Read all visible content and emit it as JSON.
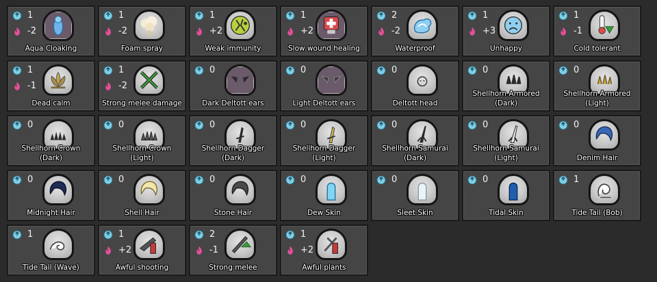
{
  "colors": {
    "background": "#2b2b2b",
    "card": "#454545",
    "water_icon": "#7ecfe6",
    "fire_icon": "#e64f9a"
  },
  "traits": [
    {
      "name": "Aqua Cloaking",
      "water": "1",
      "fire": "-2",
      "icon": "aqua-cloaking-icon"
    },
    {
      "name": "Foam spray",
      "water": "1",
      "fire": "-2",
      "icon": "foam-spray-icon"
    },
    {
      "name": "Weak immunity",
      "water": "1",
      "fire": "+2",
      "icon": "weak-immunity-icon"
    },
    {
      "name": "Slow wound healing",
      "water": "1",
      "fire": "+2",
      "icon": "slow-wound-healing-icon"
    },
    {
      "name": "Waterproof",
      "water": "2",
      "fire": "-2",
      "icon": "waterproof-icon"
    },
    {
      "name": "Unhappy",
      "water": "1",
      "fire": "+3",
      "icon": "unhappy-icon"
    },
    {
      "name": "Cold tolerant",
      "water": "1",
      "fire": "-1",
      "icon": "cold-tolerant-icon"
    },
    {
      "name": "Dead calm",
      "water": "1",
      "fire": "-1",
      "icon": "dead-calm-icon"
    },
    {
      "name": "Strong melee damage",
      "water": "1",
      "fire": "-2",
      "icon": "strong-melee-damage-icon"
    },
    {
      "name": "Dark Deltott ears",
      "water": "0",
      "fire": null,
      "icon": "dark-deltott-ears-icon"
    },
    {
      "name": "Light Deltott ears",
      "water": "0",
      "fire": null,
      "icon": "light-deltott-ears-icon"
    },
    {
      "name": "Deltott head",
      "water": "0",
      "fire": null,
      "icon": "deltott-head-icon"
    },
    {
      "name": "Shellhorn Armored (Dark)",
      "water": "0",
      "fire": null,
      "icon": "shellhorn-armored-dark-icon"
    },
    {
      "name": "Shellhorn Armored (Light)",
      "water": "0",
      "fire": null,
      "icon": "shellhorn-armored-light-icon"
    },
    {
      "name": "Shellhorn Crown (Dark)",
      "water": "0",
      "fire": null,
      "icon": "shellhorn-crown-dark-icon"
    },
    {
      "name": "Shellhorn Crown (Light)",
      "water": "0",
      "fire": null,
      "icon": "shellhorn-crown-light-icon"
    },
    {
      "name": "Shellhorn Dagger (Dark)",
      "water": "0",
      "fire": null,
      "icon": "shellhorn-dagger-dark-icon"
    },
    {
      "name": "Shellhorn Dagger (Light)",
      "water": "0",
      "fire": null,
      "icon": "shellhorn-dagger-light-icon"
    },
    {
      "name": "Shellhorn Samurai (Dark)",
      "water": "0",
      "fire": null,
      "icon": "shellhorn-samurai-dark-icon"
    },
    {
      "name": "Shellhorn Samurai (Light)",
      "water": "0",
      "fire": null,
      "icon": "shellhorn-samurai-light-icon"
    },
    {
      "name": "Denim Hair",
      "water": "0",
      "fire": null,
      "icon": "denim-hair-icon"
    },
    {
      "name": "Midnight Hair",
      "water": "0",
      "fire": null,
      "icon": "midnight-hair-icon"
    },
    {
      "name": "Shell Hair",
      "water": "0",
      "fire": null,
      "icon": "shell-hair-icon"
    },
    {
      "name": "Stone Hair",
      "water": "0",
      "fire": null,
      "icon": "stone-hair-icon"
    },
    {
      "name": "Dew Skin",
      "water": "0",
      "fire": null,
      "icon": "dew-skin-icon"
    },
    {
      "name": "Sleet Skin",
      "water": "0",
      "fire": null,
      "icon": "sleet-skin-icon"
    },
    {
      "name": "Tidal Skin",
      "water": "0",
      "fire": null,
      "icon": "tidal-skin-icon"
    },
    {
      "name": "Tide Tail (Bob)",
      "water": "1",
      "fire": null,
      "icon": "tide-tail-bob-icon"
    },
    {
      "name": "Tide Tail (Wave)",
      "water": "1",
      "fire": null,
      "icon": "tide-tail-wave-icon"
    },
    {
      "name": "Awful shooting",
      "water": "1",
      "fire": "+2",
      "icon": "awful-shooting-icon"
    },
    {
      "name": "Strong melee",
      "water": "2",
      "fire": "-1",
      "icon": "strong-melee-icon"
    },
    {
      "name": "Awful plants",
      "water": "1",
      "fire": "+2",
      "icon": "awful-plants-icon"
    }
  ]
}
